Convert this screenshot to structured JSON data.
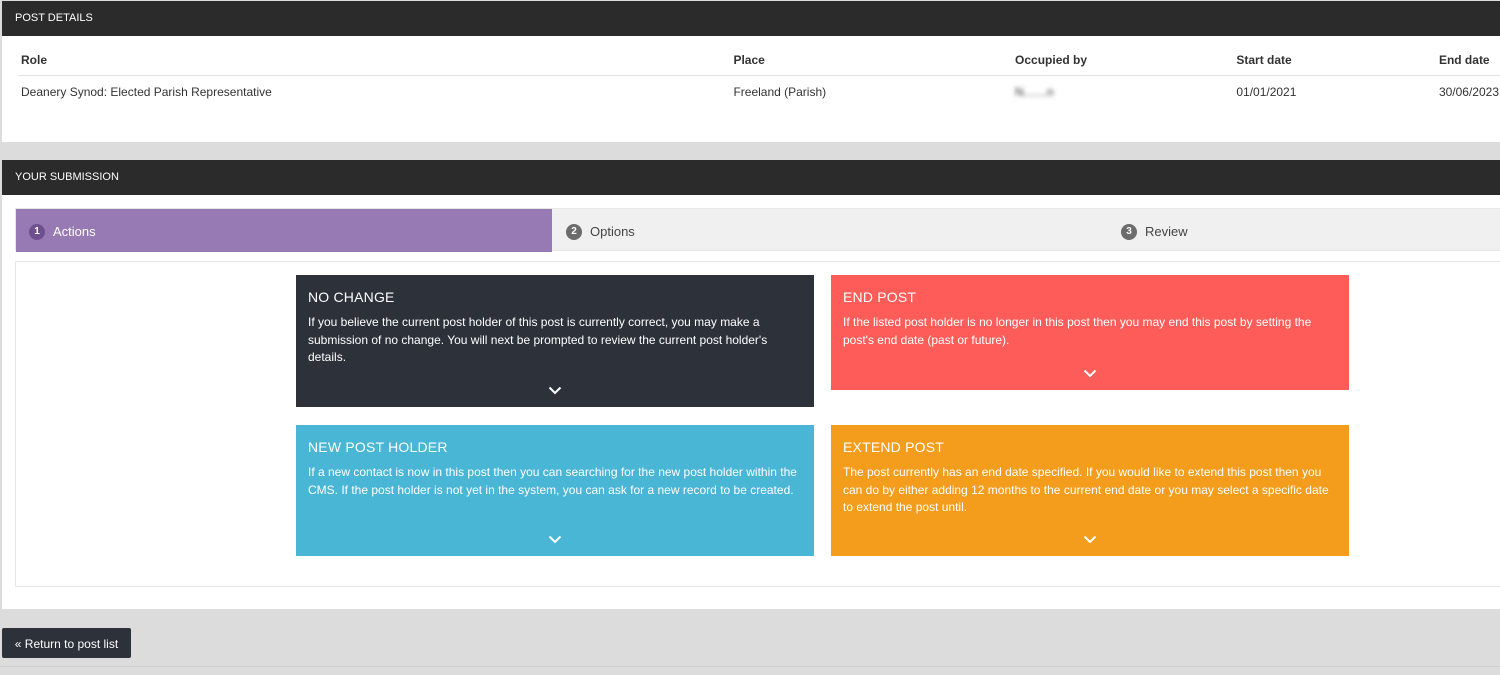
{
  "post_details": {
    "heading": "POST DETAILS",
    "columns": [
      "Role",
      "Place",
      "Occupied by",
      "Start date",
      "End date"
    ],
    "row": {
      "role": "Deanery Synod: Elected Parish Representative",
      "place": "Freeland (Parish)",
      "occupied_by": "N.......n",
      "start_date": "01/01/2021",
      "end_date": "30/06/2023"
    }
  },
  "submission": {
    "heading": "YOUR SUBMISSION",
    "steps": [
      {
        "num": "1",
        "label": "Actions"
      },
      {
        "num": "2",
        "label": "Options"
      },
      {
        "num": "3",
        "label": "Review"
      }
    ],
    "cards": {
      "no_change": {
        "title": "NO CHANGE",
        "text": "If you believe the current post holder of this post is currently correct, you may make a submission of no change. You will next be prompted to review the current post holder's details.",
        "color": "#2d3139"
      },
      "end_post": {
        "title": "END POST",
        "text": "If the listed post holder is no longer in this post then you may end this post by setting the post's end date (past or future).",
        "color": "#fd5c58"
      },
      "new_post_holder": {
        "title": "NEW POST HOLDER",
        "text": "If a new contact is now in this post then you can searching for the new post holder within the CMS. If the post holder is not yet in the system, you can ask for a new record to be created.",
        "color": "#49b6d6"
      },
      "extend_post": {
        "title": "EXTEND POST",
        "text": "The post currently has an end date specified. If you would like to extend this post then you can do by either adding 12 months to the current end date or you may select a specific date to extend the post until.",
        "color": "#f49c1b"
      }
    }
  },
  "footer": {
    "return_label": "« Return to post list"
  },
  "colors": {
    "header_bar": "#2b2b2b",
    "active_step": "#9779b4"
  }
}
